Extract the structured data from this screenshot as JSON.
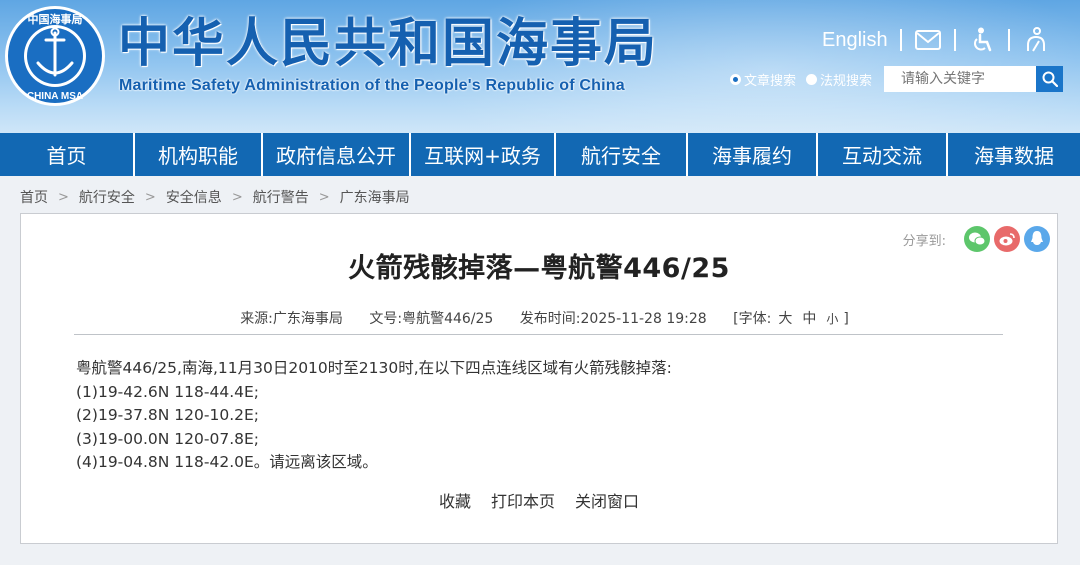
{
  "header": {
    "emblem_text_top": "中国海事局",
    "emblem_text_bottom": "CHINA MSA",
    "title_cn": "中华人民共和国海事局",
    "title_en": "Maritime Safety Administration of the People's Republic of China",
    "english_link": "English",
    "icons": [
      "mail-icon",
      "accessibility-icon",
      "elderly-mode-icon"
    ]
  },
  "search": {
    "options": [
      {
        "label": "文章搜索",
        "selected": true
      },
      {
        "label": "法规搜索",
        "selected": false
      }
    ],
    "placeholder": "请输入关键字"
  },
  "nav": {
    "items": [
      "首页",
      "机构职能",
      "政府信息公开",
      "互联网+政务",
      "航行安全",
      "海事履约",
      "互动交流",
      "海事数据"
    ]
  },
  "breadcrumb": [
    "首页",
    "航行安全",
    "安全信息",
    "航行警告",
    "广东海事局"
  ],
  "share": {
    "label": "分享到:",
    "targets": [
      {
        "name": "wechat",
        "color": "#5dc66b"
      },
      {
        "name": "weibo",
        "color": "#e86a6a"
      },
      {
        "name": "qq",
        "color": "#5aa8ea"
      }
    ]
  },
  "article": {
    "title": "火箭残骸掉落—粤航警446/25",
    "source": "来源:广东海事局",
    "doc_no": "文号:粤航警446/25",
    "published": "发布时间:2025-11-28 19:28",
    "font_label": "[字体:",
    "font_large": "大",
    "font_medium": "中",
    "font_small": "小",
    "font_close": "]",
    "lines": [
      "粤航警446/25,南海,11月30日2010时至2130时,在以下四点连线区域有火箭残骸掉落:",
      "(1)19-42.6N 118-44.4E;",
      "(2)19-37.8N 120-10.2E;",
      "(3)19-00.0N 120-07.8E;",
      "(4)19-04.8N 118-42.0E。请远离该区域。"
    ],
    "actions": [
      "收藏",
      "打印本页",
      "关闭窗口"
    ]
  }
}
